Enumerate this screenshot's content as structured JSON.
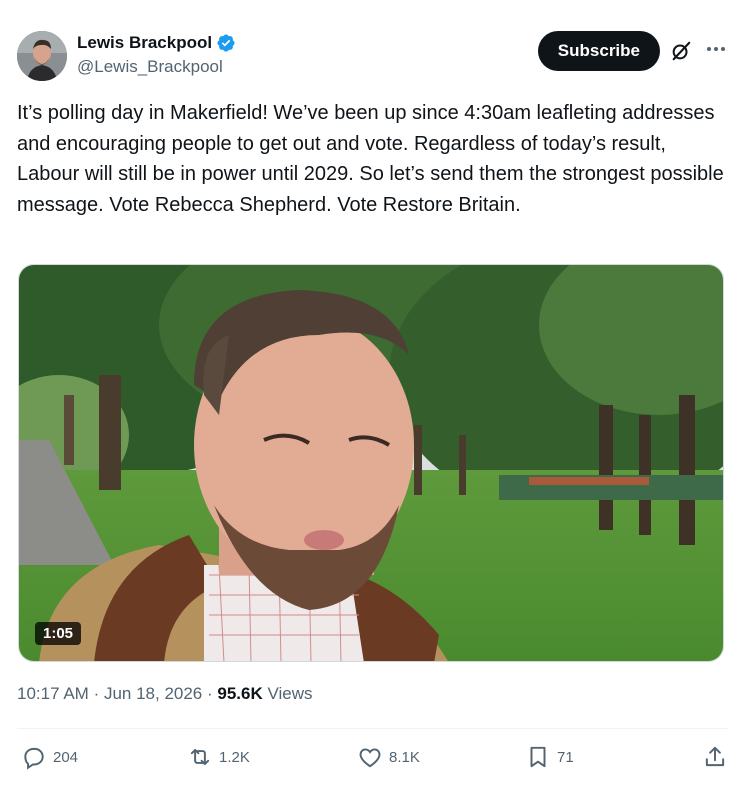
{
  "author": {
    "display_name": "Lewis Brackpool",
    "handle": "@Lewis_Brackpool",
    "verified": true
  },
  "header": {
    "subscribe_label": "Subscribe"
  },
  "tweet": {
    "text": "It’s polling day in Makerfield! We’ve been up since 4:30am leafleting addresses and encouraging people to get out and vote. Regardless of today’s result, Labour will still be in power until 2029. So let’s send them the strongest possible message. Vote Rebecca Shepherd. Vote Restore Britain.",
    "video_duration": "1:05"
  },
  "meta": {
    "time": "10:17 AM",
    "date": "Jun 18, 2026",
    "views_count": "95.6K",
    "views_label": "Views"
  },
  "actions": {
    "replies": "204",
    "reposts": "1.2K",
    "likes": "8.1K",
    "bookmarks": "71"
  },
  "colors": {
    "verified_blue": "#1d9bf0",
    "text_primary": "#0f1419",
    "text_secondary": "#536471",
    "subscribe_bg": "#0f1419"
  }
}
